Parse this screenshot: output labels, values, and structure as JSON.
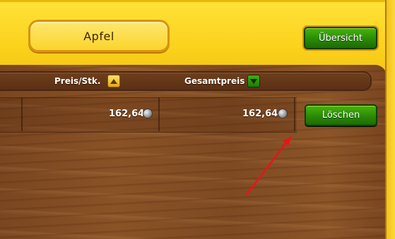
{
  "product": {
    "name": "Apfel"
  },
  "toolbar": {
    "overview_label": "Übersicht"
  },
  "columns": {
    "unit_price": {
      "label": "Preis/Stk.",
      "sort": "ascending"
    },
    "total_price": {
      "label": "Gesamtpreis",
      "sort": "descending"
    }
  },
  "rows": [
    {
      "unit_price": "162,64",
      "total_price": "162,64",
      "delete_label": "Löschen"
    }
  ],
  "colors": {
    "header_yellow": "#fbd21c",
    "button_green": "#2a8a06",
    "wood_brown": "#8a5226",
    "arrow_red": "#e8141a"
  }
}
